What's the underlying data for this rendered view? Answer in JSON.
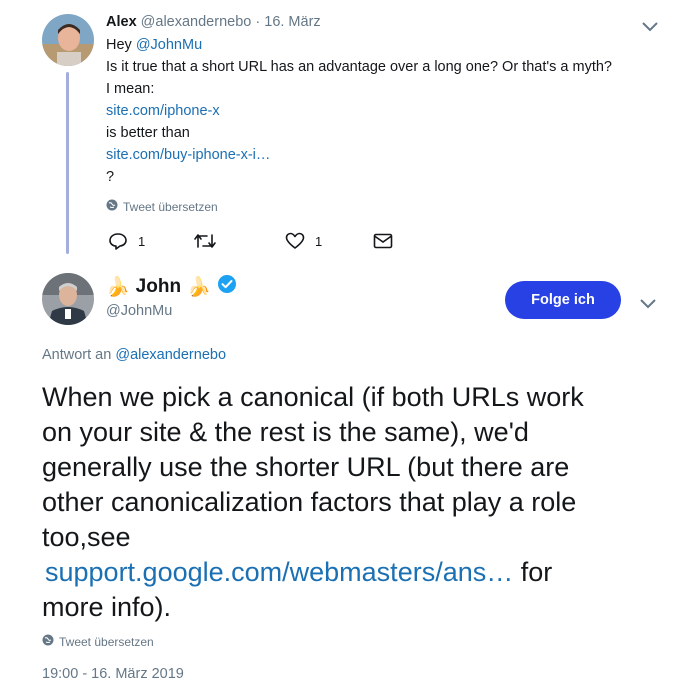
{
  "parent": {
    "name": "Alex",
    "handle": "@alexandernebo",
    "sep": "·",
    "date": "16. März",
    "lines": [
      {
        "pre": "Hey ",
        "link": "@JohnMu"
      },
      {
        "text": "Is it true that a short URL has an advantage over a long one? Or that's a myth?"
      },
      {
        "text": "I mean:"
      },
      {
        "link": "site.com/iphone-x"
      },
      {
        "text": "is better than"
      },
      {
        "link": "site.com/buy-iphone-x-i…"
      },
      {
        "text": "?"
      }
    ],
    "translate": "Tweet übersetzen",
    "reply_count": "1",
    "like_count": "1"
  },
  "main": {
    "name_emoji_left": "🍌",
    "name": "John",
    "name_emoji_right": "🍌",
    "handle": "@JohnMu",
    "follow_label": "Folge ich",
    "reply_to_prefix": "Antwort an ",
    "reply_to_handle": "@alexandernebo",
    "body_lines": [
      "When we pick a canonical (if both URLs work",
      "on your site & the rest is the same), we'd",
      "generally use the shorter URL (but there are",
      "other canonicalization factors that play a role",
      "too,see"
    ],
    "body_link": "support.google.com/webmasters/ans…",
    "body_after_link": " for",
    "body_last": "more info).",
    "translate": "Tweet übersetzen",
    "timestamp": "19:00 - 16. März 2019"
  },
  "colors": {
    "accent": "#2741e4",
    "link": "#1b6fb3",
    "verified": "#1da1f2",
    "thread_line": "#a3aedd"
  }
}
